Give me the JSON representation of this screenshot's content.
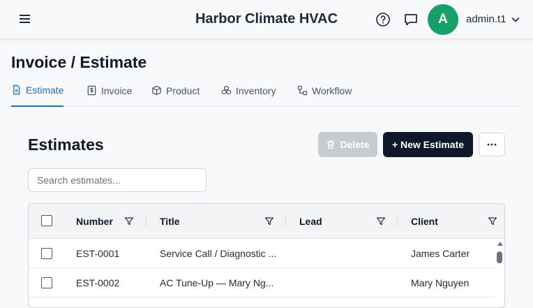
{
  "header": {
    "app_title": "Harbor Climate HVAC",
    "avatar_initial": "A",
    "username": "admin.t1",
    "icons": [
      "menu-icon",
      "help-icon",
      "chat-icon",
      "chevron-down-icon"
    ]
  },
  "page": {
    "title": "Invoice / Estimate"
  },
  "tabs": [
    {
      "label": "Estimate",
      "icon": "document-icon",
      "active": true
    },
    {
      "label": "Invoice",
      "icon": "dollar-doc-icon",
      "active": false
    },
    {
      "label": "Product",
      "icon": "box-icon",
      "active": false
    },
    {
      "label": "Inventory",
      "icon": "boxes-icon",
      "active": false
    },
    {
      "label": "Workflow",
      "icon": "workflow-icon",
      "active": false
    }
  ],
  "section": {
    "title": "Estimates",
    "delete_label": "Delete",
    "new_label": "+ New Estimate",
    "search_placeholder": "Search estimates..."
  },
  "table": {
    "columns": [
      "Number",
      "Title",
      "Lead",
      "Client"
    ],
    "rows": [
      {
        "number": "EST-0001",
        "title": "Service Call / Diagnostic ...",
        "lead": "",
        "client": "James Carter"
      },
      {
        "number": "EST-0002",
        "title": "AC Tune-Up — Mary Ng...",
        "lead": "",
        "client": "Mary Nguyen"
      }
    ]
  },
  "colors": {
    "accent": "#1d6fd6",
    "avatar": "#16a06a",
    "primary_button": "#0f172a",
    "disabled_button": "#c7ccd3"
  }
}
